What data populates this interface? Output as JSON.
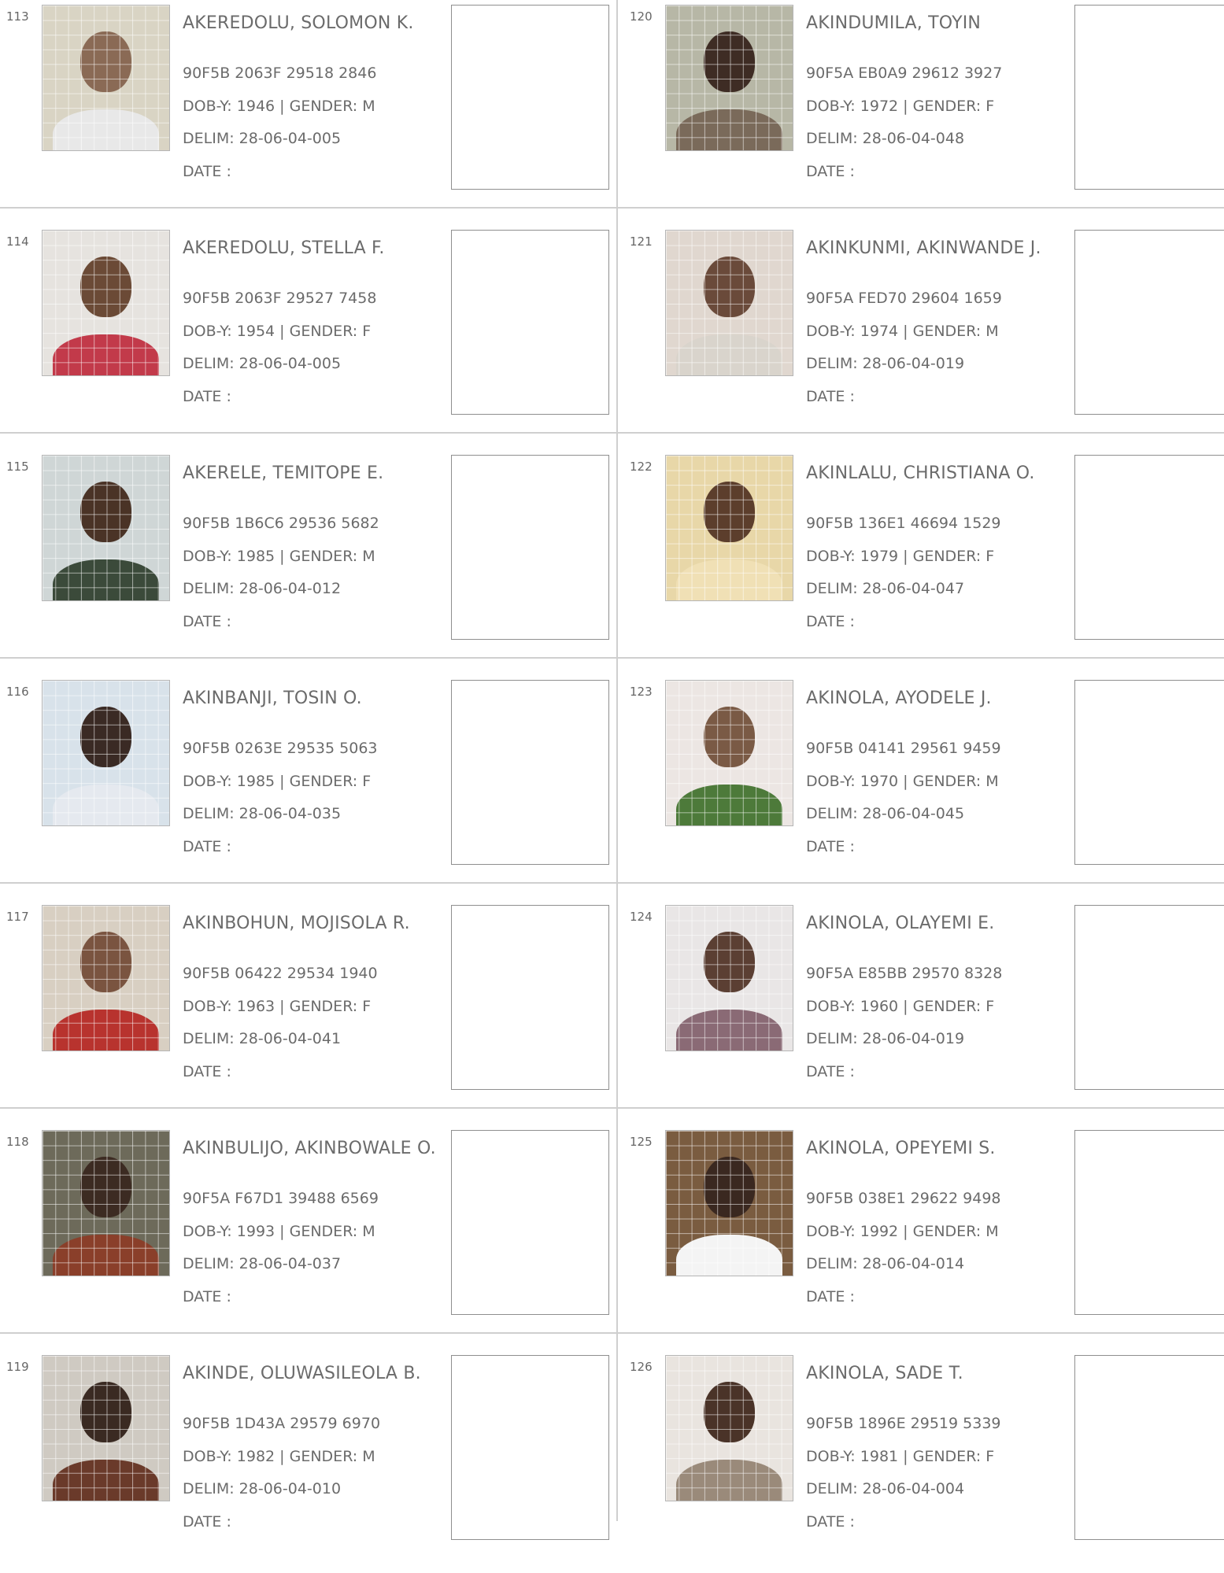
{
  "labels": {
    "dob": "DOB-Y:",
    "gender_sep": "| GENDER:",
    "delim": "DELIM:",
    "date": "DATE :"
  },
  "left": [
    {
      "serial": "113",
      "name": "AKEREDOLU, SOLOMON K.",
      "vin": "90F5B 2063F 29518 2846",
      "dob": "1946",
      "gender": "M",
      "delim": "28-06-04-005"
    },
    {
      "serial": "114",
      "name": "AKEREDOLU, STELLA F.",
      "vin": "90F5B 2063F 29527 7458",
      "dob": "1954",
      "gender": "F",
      "delim": "28-06-04-005"
    },
    {
      "serial": "115",
      "name": "AKERELE, TEMITOPE E.",
      "vin": "90F5B 1B6C6 29536 5682",
      "dob": "1985",
      "gender": "M",
      "delim": "28-06-04-012"
    },
    {
      "serial": "116",
      "name": "AKINBANJI, TOSIN O.",
      "vin": "90F5B 0263E 29535 5063",
      "dob": "1985",
      "gender": "F",
      "delim": "28-06-04-035"
    },
    {
      "serial": "117",
      "name": "AKINBOHUN, MOJISOLA R.",
      "vin": "90F5B 06422 29534 1940",
      "dob": "1963",
      "gender": "F",
      "delim": "28-06-04-041"
    },
    {
      "serial": "118",
      "name": "AKINBULIJO, AKINBOWALE O.",
      "vin": "90F5A F67D1 39488 6569",
      "dob": "1993",
      "gender": "M",
      "delim": "28-06-04-037"
    },
    {
      "serial": "119",
      "name": "AKINDE, OLUWASILEOLA B.",
      "vin": "90F5B 1D43A 29579 6970",
      "dob": "1982",
      "gender": "M",
      "delim": "28-06-04-010"
    }
  ],
  "right": [
    {
      "serial": "120",
      "name": "AKINDUMILA, TOYIN",
      "vin": "90F5A EB0A9 29612 3927",
      "dob": "1972",
      "gender": "F",
      "delim": "28-06-04-048"
    },
    {
      "serial": "121",
      "name": "AKINKUNMI, AKINWANDE J.",
      "vin": "90F5A FED70 29604 1659",
      "dob": "1974",
      "gender": "M",
      "delim": "28-06-04-019"
    },
    {
      "serial": "122",
      "name": "AKINLALU, CHRISTIANA O.",
      "vin": "90F5B 136E1 46694 1529",
      "dob": "1979",
      "gender": "F",
      "delim": "28-06-04-047"
    },
    {
      "serial": "123",
      "name": "AKINOLA, AYODELE J.",
      "vin": "90F5B 04141 29561 9459",
      "dob": "1970",
      "gender": "M",
      "delim": "28-06-04-045"
    },
    {
      "serial": "124",
      "name": "AKINOLA, OLAYEMI E.",
      "vin": "90F5A E85BB 29570 8328",
      "dob": "1960",
      "gender": "F",
      "delim": "28-06-04-019"
    },
    {
      "serial": "125",
      "name": "AKINOLA, OPEYEMI S.",
      "vin": "90F5B 038E1 29622 9498",
      "dob": "1992",
      "gender": "M",
      "delim": "28-06-04-014"
    },
    {
      "serial": "126",
      "name": "AKINOLA, SADE T.",
      "vin": "90F5B 1896E 29519 5339",
      "dob": "1981",
      "gender": "F",
      "delim": "28-06-04-004"
    }
  ]
}
